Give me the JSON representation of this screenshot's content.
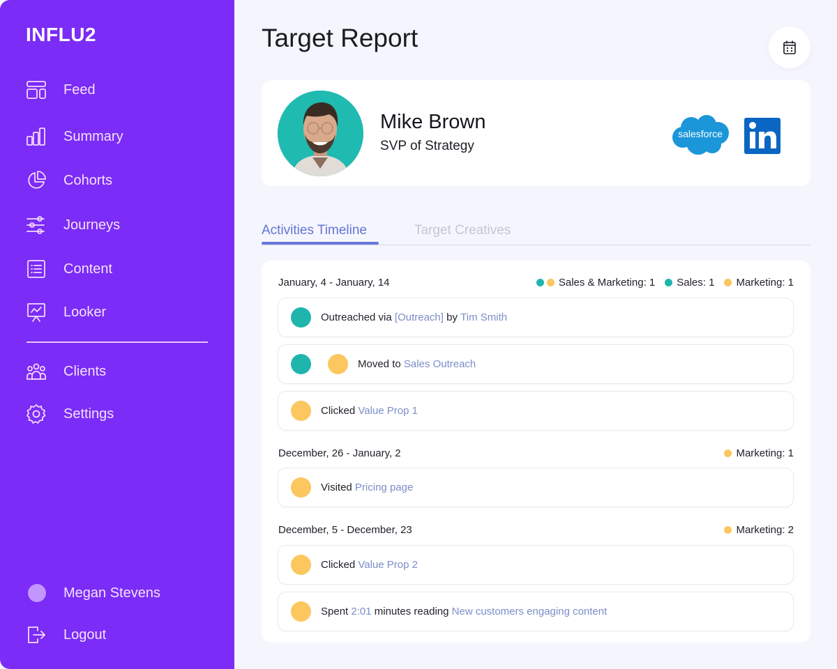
{
  "app": {
    "logo": "INFLU2"
  },
  "sidebar": {
    "items": [
      {
        "label": "Feed",
        "icon": "feed-layout-icon"
      },
      {
        "label": "Summary",
        "icon": "bar-chart-icon"
      },
      {
        "label": "Cohorts",
        "icon": "pie-chart-icon"
      },
      {
        "label": "Journeys",
        "icon": "sliders-icon"
      },
      {
        "label": "Content",
        "icon": "list-icon"
      },
      {
        "label": "Looker",
        "icon": "presentation-chart-icon"
      }
    ],
    "secondary_items": [
      {
        "label": "Clients",
        "icon": "users-icon"
      },
      {
        "label": "Settings",
        "icon": "gear-icon"
      }
    ],
    "user": {
      "name": "Megan Stevens"
    },
    "logout_label": "Logout"
  },
  "header": {
    "title": "Target Report",
    "calendar_icon": "calendar-icon"
  },
  "profile": {
    "name": "Mike Brown",
    "title": "SVP of Strategy",
    "salesforce_label": "salesforce",
    "linkedin_label": "in"
  },
  "tabs": [
    {
      "label": "Activities Timeline",
      "active": true
    },
    {
      "label": "Target Creatives",
      "active": false
    }
  ],
  "colors": {
    "sidebar": "#7b2cf6",
    "sales": "#1fb5ac",
    "marketing": "#fbc75e",
    "link": "#7b8ec8",
    "tab_active": "#6474d4"
  },
  "timeline": {
    "groups": [
      {
        "range": "January, 4 - January, 14",
        "legend": [
          {
            "label": "Sales & Marketing: 1"
          },
          {
            "label": "Sales: 1"
          },
          {
            "label": "Marketing: 1"
          }
        ],
        "activities": [
          {
            "parts": [
              "Outreached via ",
              "[Outreach]",
              " by ",
              "Tim Smith"
            ],
            "type": "Sales"
          },
          {
            "parts": [
              "Moved to ",
              "Sales Outreach"
            ],
            "type": "Sales & Marketing"
          },
          {
            "parts": [
              "Clicked ",
              "Value Prop 1"
            ],
            "type": "Marketing"
          }
        ]
      },
      {
        "range": "December, 26 - January, 2",
        "legend": [
          {
            "label": "Marketing: 1"
          }
        ],
        "activities": [
          {
            "parts": [
              "Visited ",
              "Pricing page"
            ],
            "type": "Marketing"
          }
        ]
      },
      {
        "range": "December, 5 - December, 23",
        "legend": [
          {
            "label": "Marketing: 2"
          }
        ],
        "activities": [
          {
            "parts": [
              "Clicked ",
              "Value Prop 2"
            ],
            "type": "Marketing"
          },
          {
            "parts": [
              "Spent ",
              "2:01",
              " minutes reading ",
              "New customers engaging content"
            ],
            "type": "Marketing"
          }
        ]
      }
    ]
  }
}
